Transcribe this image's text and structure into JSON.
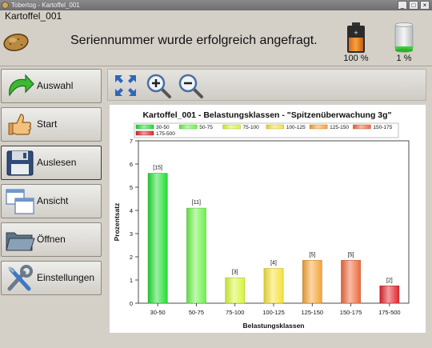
{
  "window": {
    "title": "Tobertog - Kartoffel_001"
  },
  "header": {
    "device_label": "Kartoffel_001",
    "status_message": "Seriennummer wurde erfolgreich angefragt.",
    "gauges": [
      {
        "icon": "battery-icon",
        "label": "100 %",
        "level_percent": 100
      },
      {
        "icon": "memory-icon",
        "label": "1 %",
        "level_percent": 1
      }
    ]
  },
  "sidebar": {
    "items": [
      {
        "label": "Auswahl",
        "icon": "arrow-icon"
      },
      {
        "label": "Start",
        "icon": "thumbs-up-icon"
      },
      {
        "label": "Auslesen",
        "icon": "floppy-disk-icon"
      },
      {
        "label": "Ansicht",
        "icon": "windows-icon"
      },
      {
        "label": "Öffnen",
        "icon": "folder-icon"
      },
      {
        "label": "Einstellungen",
        "icon": "tools-icon"
      }
    ]
  },
  "toolbar": {
    "tools": [
      "fit-view-icon",
      "zoom-in-icon",
      "zoom-out-icon"
    ]
  },
  "chart_data": {
    "type": "bar",
    "title": "Kartoffel_001 - Belastungsklassen - \"Spitzenüberwachung 3g\"",
    "xlabel": "Belastungsklassen",
    "ylabel": "Prozentsatz",
    "ylim": [
      0,
      7
    ],
    "yticks": [
      0,
      1,
      2,
      3,
      4,
      5,
      6,
      7
    ],
    "grid": false,
    "legend_position": "top",
    "categories": [
      "30-50",
      "50-75",
      "75-100",
      "100-125",
      "125-150",
      "150-175",
      "175-500"
    ],
    "values": [
      5.6,
      4.1,
      1.1,
      1.5,
      1.85,
      1.85,
      0.75
    ],
    "data_labels": [
      "[15]",
      "[11]",
      "[3]",
      "[4]",
      "[5]",
      "[5]",
      "[2]"
    ],
    "colors": [
      "#22dd33",
      "#6cf24a",
      "#d7f53a",
      "#f5e13a",
      "#f4a437",
      "#ee6a3c",
      "#e0252c"
    ]
  }
}
